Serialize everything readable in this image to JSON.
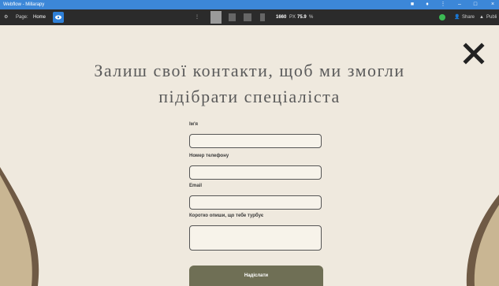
{
  "window": {
    "title": "Webflow - Millarapy"
  },
  "toolbar": {
    "page_label": "Page:",
    "page_name": "Home",
    "width_value": "1660",
    "width_unit": "PX",
    "zoom_value": "75.9",
    "zoom_unit": "%",
    "share_label": "Share",
    "publish_label": "Publi"
  },
  "content": {
    "heading_line1": "Залиш свої контакти, щоб ми змогли",
    "heading_line2": "підібрати спеціаліста"
  },
  "form": {
    "name_label": "Ім'я",
    "phone_label": "Номер телефону",
    "email_label": "Email",
    "message_label": "Коротко опиши, що тебе турбує",
    "submit_label": "Надіслати"
  },
  "colors": {
    "titlebar": "#3c87d8",
    "toolbar": "#2b2b2b",
    "page_background": "#efe9de",
    "decoration_brown": "#6f5a45",
    "decoration_tan": "#c9b693",
    "submit_button": "#6f6f55",
    "status_green": "#3cba54"
  },
  "icons": [
    "close-icon",
    "eye-icon",
    "user-icon",
    "publish-icon",
    "settings-icon"
  ]
}
